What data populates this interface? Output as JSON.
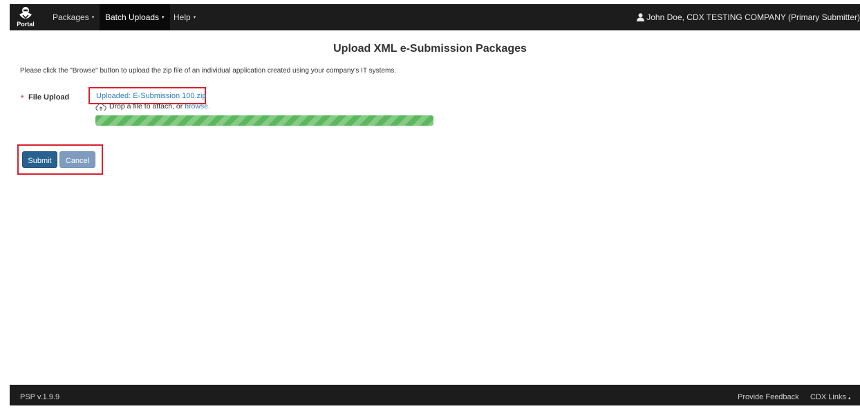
{
  "navbar": {
    "logo_text": "Portal",
    "items": [
      {
        "label": "Packages",
        "caret": "▾"
      },
      {
        "label": "Batch Uploads",
        "caret": "▾"
      },
      {
        "label": "Help",
        "caret": "▾"
      }
    ],
    "user_label": "John Doe, CDX TESTING COMPANY (Primary Submitter)",
    "user_icon": "user-icon"
  },
  "page": {
    "title": "Upload XML e-Submission Packages",
    "instructions": "Please click the \"Browse\" button to upload the zip file of an individual application created using your company's IT systems."
  },
  "form": {
    "required_marker": "*",
    "field_label": "File Upload",
    "uploaded_text": "Uploaded: E-Submission 100.zip",
    "drop_text": "Drop a file to attach, or ",
    "browse_text": "browse.",
    "upload_icon": "cloud-upload-icon",
    "progress_fraction": 1.0,
    "progress_color": "#5cb85c"
  },
  "buttons": {
    "submit_label": "Submit",
    "cancel_label": "Cancel"
  },
  "highlight_color": "#d9212f",
  "footer": {
    "version": "PSP v.1.9.9",
    "feedback_label": "Provide Feedback",
    "cdx_links_label": "CDX Links",
    "cdx_caret": "▴"
  }
}
